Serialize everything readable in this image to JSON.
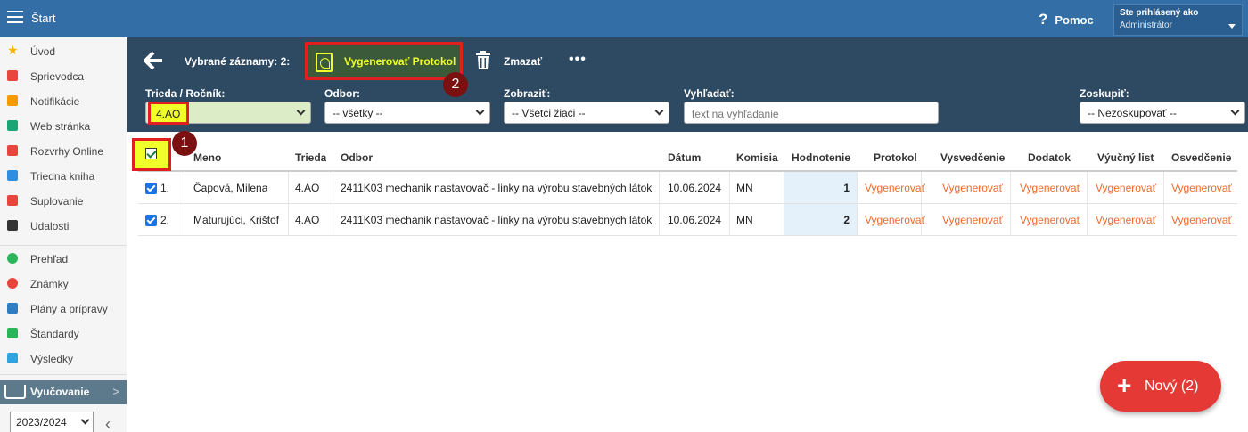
{
  "topbar": {
    "title": "Štart",
    "help_label": "Pomoc",
    "user_label": "Ste prihlásený ako",
    "user_role": "Administrátor"
  },
  "sidebar": {
    "items": [
      {
        "label": "Úvod",
        "icon": "star-icon",
        "color": "#f5b400"
      },
      {
        "label": "Sprievodca",
        "icon": "wand-icon",
        "color": "#e8453c"
      },
      {
        "label": "Notifikácie",
        "icon": "envelope-icon",
        "color": "#f59a00"
      },
      {
        "label": "Web stránka",
        "icon": "home-icon",
        "color": "#1aa575"
      },
      {
        "label": "Rozvrhy Online",
        "icon": "calendar-icon",
        "color": "#e8453c"
      },
      {
        "label": "Triedna kniha",
        "icon": "book-icon",
        "color": "#2f8ee0"
      },
      {
        "label": "Suplovanie",
        "icon": "user-swap-icon",
        "color": "#e8453c"
      },
      {
        "label": "Udalosti",
        "icon": "calendar-dark-icon",
        "color": "#333"
      },
      {
        "label": "Prehľad",
        "icon": "check-circle-icon",
        "color": "#2bb55a"
      },
      {
        "label": "Známky",
        "icon": "grade-icon",
        "color": "#e8453c"
      },
      {
        "label": "Plány a prípravy",
        "icon": "briefcase-icon",
        "color": "#2f7ec4"
      },
      {
        "label": "Štandardy",
        "icon": "shield-icon",
        "color": "#2bb55a"
      },
      {
        "label": "Výsledky",
        "icon": "bar-chart-icon",
        "color": "#2fa4e0"
      }
    ],
    "section_label": "Vyučovanie",
    "year": "2023/2024"
  },
  "actionbar": {
    "selected_text": "Vybrané záznamy: 2:",
    "generate_label": "Vygenerovať Protokol",
    "delete_label": "Zmazať",
    "more_label": "•••"
  },
  "filters": {
    "class_label": "Trieda / Ročník:",
    "class_value": "4.AO",
    "field_label": "Odbor:",
    "field_value": "-- všetky --",
    "show_label": "Zobraziť:",
    "show_value": "-- Všetci žiaci --",
    "search_label": "Vyhľadať:",
    "search_placeholder": "text na vyhľadanie",
    "group_label": "Zoskupiť:",
    "group_value": "-- Nezoskupovať --"
  },
  "badges": {
    "one": "1",
    "two": "2"
  },
  "table": {
    "columns": [
      "Meno",
      "Trieda",
      "Odbor",
      "Dátum",
      "Komisia",
      "Hodnotenie",
      "Protokol",
      "Vysvedčenie",
      "Dodatok",
      "Výučný list",
      "Osvedčenie"
    ],
    "rows": [
      {
        "num": "1.",
        "name": "Čapová, Milena",
        "class": "4.AO",
        "field": "2411K03 mechanik nastavovač - linky na výrobu stavebných látok",
        "date": "10.06.2024",
        "board": "MN",
        "grade": "1",
        "protocol": "Vygenerovať",
        "certificate": "Vygenerovať",
        "addendum": "Vygenerovať",
        "apprentice": "Vygenerovať",
        "attestation": "Vygenerovať"
      },
      {
        "num": "2.",
        "name": "Maturujúci, Krištof",
        "class": "4.AO",
        "field": "2411K03 mechanik nastavovač - linky na výrobu stavebných látok",
        "date": "10.06.2024",
        "board": "MN",
        "grade": "2",
        "protocol": "Vygenerovať",
        "certificate": "Vygenerovať",
        "addendum": "Vygenerovať",
        "apprentice": "Vygenerovať",
        "attestation": "Vygenerovať"
      }
    ]
  },
  "fab": {
    "label": "Nový (2)",
    "plus": "+"
  }
}
